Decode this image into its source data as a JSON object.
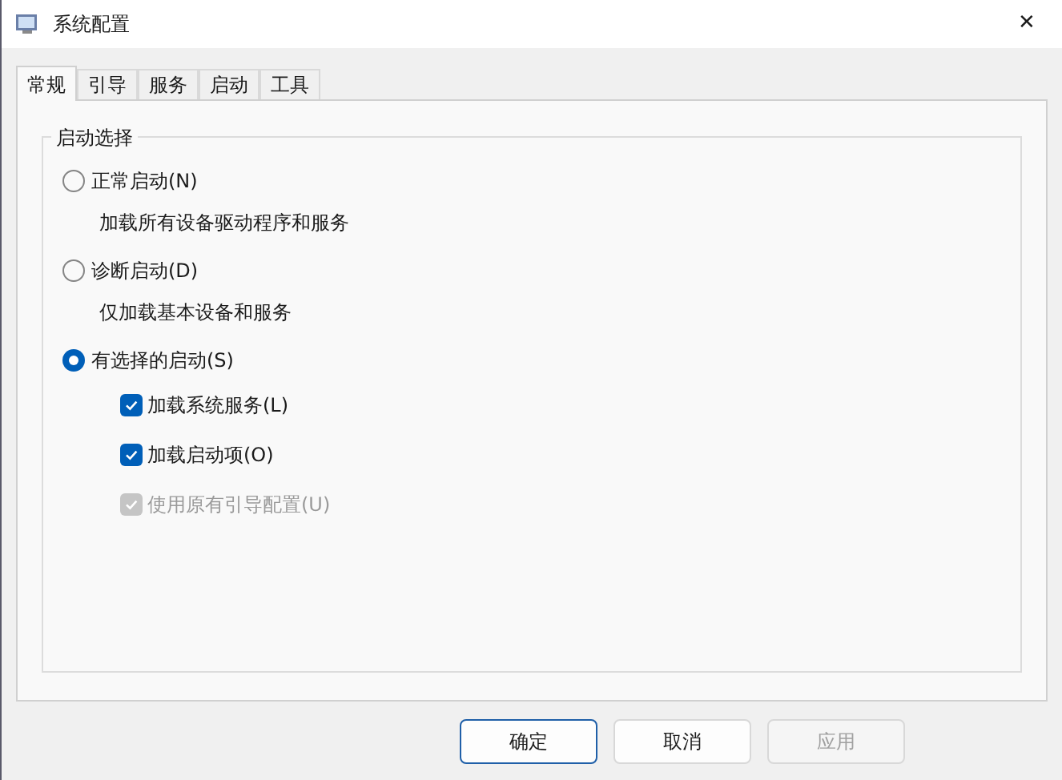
{
  "window": {
    "title": "系统配置",
    "close": "✕"
  },
  "tabs": [
    {
      "label": "常规",
      "selected": true
    },
    {
      "label": "引导",
      "selected": false
    },
    {
      "label": "服务",
      "selected": false
    },
    {
      "label": "启动",
      "selected": false
    },
    {
      "label": "工具",
      "selected": false
    }
  ],
  "group": {
    "title": "启动选择",
    "options": [
      {
        "label": "正常启动(N)",
        "description": "加载所有设备驱动程序和服务",
        "selected": false
      },
      {
        "label": "诊断启动(D)",
        "description": "仅加载基本设备和服务",
        "selected": false
      },
      {
        "label": "有选择的启动(S)",
        "selected": true
      }
    ],
    "checkboxes": [
      {
        "label": "加载系统服务(L)",
        "checked": true,
        "disabled": false
      },
      {
        "label": "加载启动项(O)",
        "checked": true,
        "disabled": false
      },
      {
        "label": "使用原有引导配置(U)",
        "checked": true,
        "disabled": true
      }
    ]
  },
  "buttons": [
    {
      "label": "确定",
      "kind": "default",
      "disabled": false
    },
    {
      "label": "取消",
      "kind": "normal",
      "disabled": false
    },
    {
      "label": "应用",
      "kind": "normal",
      "disabled": true
    }
  ]
}
